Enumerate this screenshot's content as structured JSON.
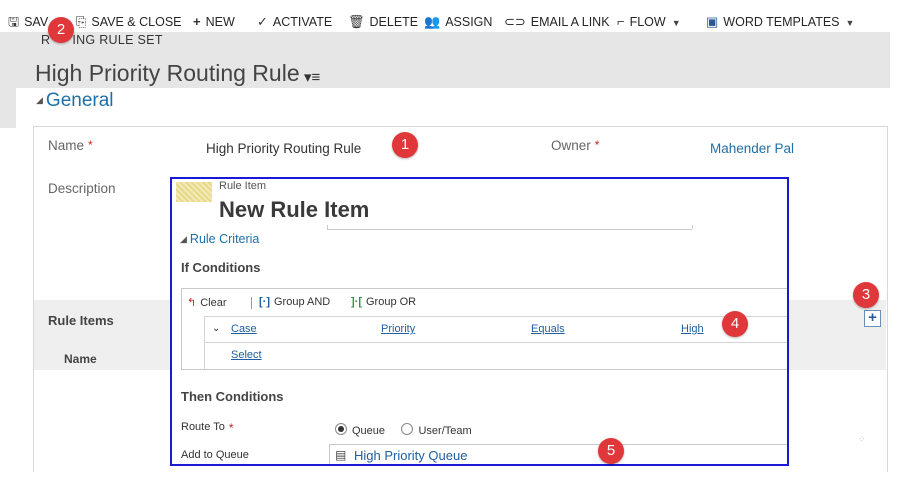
{
  "toolbar": {
    "save_label": "SAV",
    "save_close_label": "SAVE & CLOSE",
    "new_label": "NEW",
    "activate_label": "ACTIVATE",
    "delete_label": "DELETE",
    "assign_label": "ASSIGN",
    "email_link_label": "EMAIL A LINK",
    "flow_label": "FLOW",
    "word_templates_label": "WORD TEMPLATES"
  },
  "header": {
    "entity_label_a": "R",
    "entity_label_b": "ING RULE SET",
    "record_title": "High Priority Routing Rule"
  },
  "general": {
    "section_title": "General",
    "name_label": "Name",
    "name_value": "High Priority Routing Rule",
    "owner_label": "Owner",
    "owner_value": "Mahender Pal",
    "description_label": "Description",
    "required_mark": "*"
  },
  "rule_items": {
    "title": "Rule Items",
    "name_column": "Name"
  },
  "dialog": {
    "entity_label": "Rule Item",
    "title": "New Rule Item",
    "section": "Rule Criteria",
    "if_conditions": "If Conditions",
    "clear_label": "Clear",
    "group_and_label": "Group AND",
    "group_or_label": "Group OR",
    "condition": {
      "entity": "Case",
      "field": "Priority",
      "operator": "Equals",
      "value": "High"
    },
    "select_label": "Select",
    "then_conditions": "Then Conditions",
    "route_to_label": "Route To",
    "route_options": [
      "Queue",
      "User/Team"
    ],
    "route_selected": "Queue",
    "add_to_queue_label": "Add to Queue",
    "queue_value": "High Priority Queue"
  },
  "badges": [
    "1",
    "2",
    "3",
    "4",
    "5"
  ],
  "colors": {
    "badge": "#e0373a",
    "link": "#1f6fa8",
    "dialog_border": "#1a1ad6"
  }
}
